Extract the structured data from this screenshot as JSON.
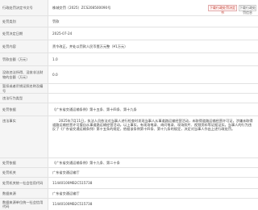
{
  "header": {
    "label": "行政处罚决定书文号",
    "value": "株城交罚〔2025〕ZCS208500090号",
    "buttons": {
      "primary": "下载行政处罚决定书",
      "secondary": "下载行政处罚信息"
    }
  },
  "fields": [
    {
      "label": "处罚类别",
      "value": "罚款"
    },
    {
      "label": "处罚决定日期",
      "value": "2025-07-24"
    },
    {
      "label": "处罚内容",
      "value": "责令改正，并处以罚款人民币壹万元整（¥1万元）"
    },
    {
      "label": "罚款金额（万元）",
      "value": "1.0"
    },
    {
      "label": "没收违法所得、没收非法财物的金额（万元）",
      "value": "0.0"
    },
    {
      "label": "暂扣或者吊销证照名称及编号",
      "value": ""
    },
    {
      "label": "违法行为类型",
      "value": ""
    },
    {
      "label": "处罚依据",
      "value": "《广东省交通运输条例》第十五条、第十四条、第十九条"
    },
    {
      "label": "违法事实",
      "value": "2025年7月11日，执法人员依法对当事人进行检查时发现当事人从事道路运输经营活动，未取得道路运输经营许可证，涉嫌未取得道路运输经营许可擅自从事道路运输经营活动。以上事实，有现场笔录、询问笔录、现场照片、视频资料等证据证实。当事人的行为违反了《广东省交通运输条例》第十五条的规定，依据该条例第十四条、第十九条的规定，决定对当事人作出上述行政处罚。"
    },
    {
      "label": "处罚依据",
      "value": "《广东省交通运输条例》第十九条、第二十条"
    },
    {
      "label": "处罚机关",
      "value": "广东省交通运输厅"
    },
    {
      "label": "处罚机关统一社会信用代码",
      "value": "11440100MB2C515738"
    },
    {
      "label": "数据来源",
      "value": "广东省交通运输厅"
    },
    {
      "label": "数据来源单位统一社会信用代码",
      "value": "11440100MB2C515738"
    }
  ]
}
